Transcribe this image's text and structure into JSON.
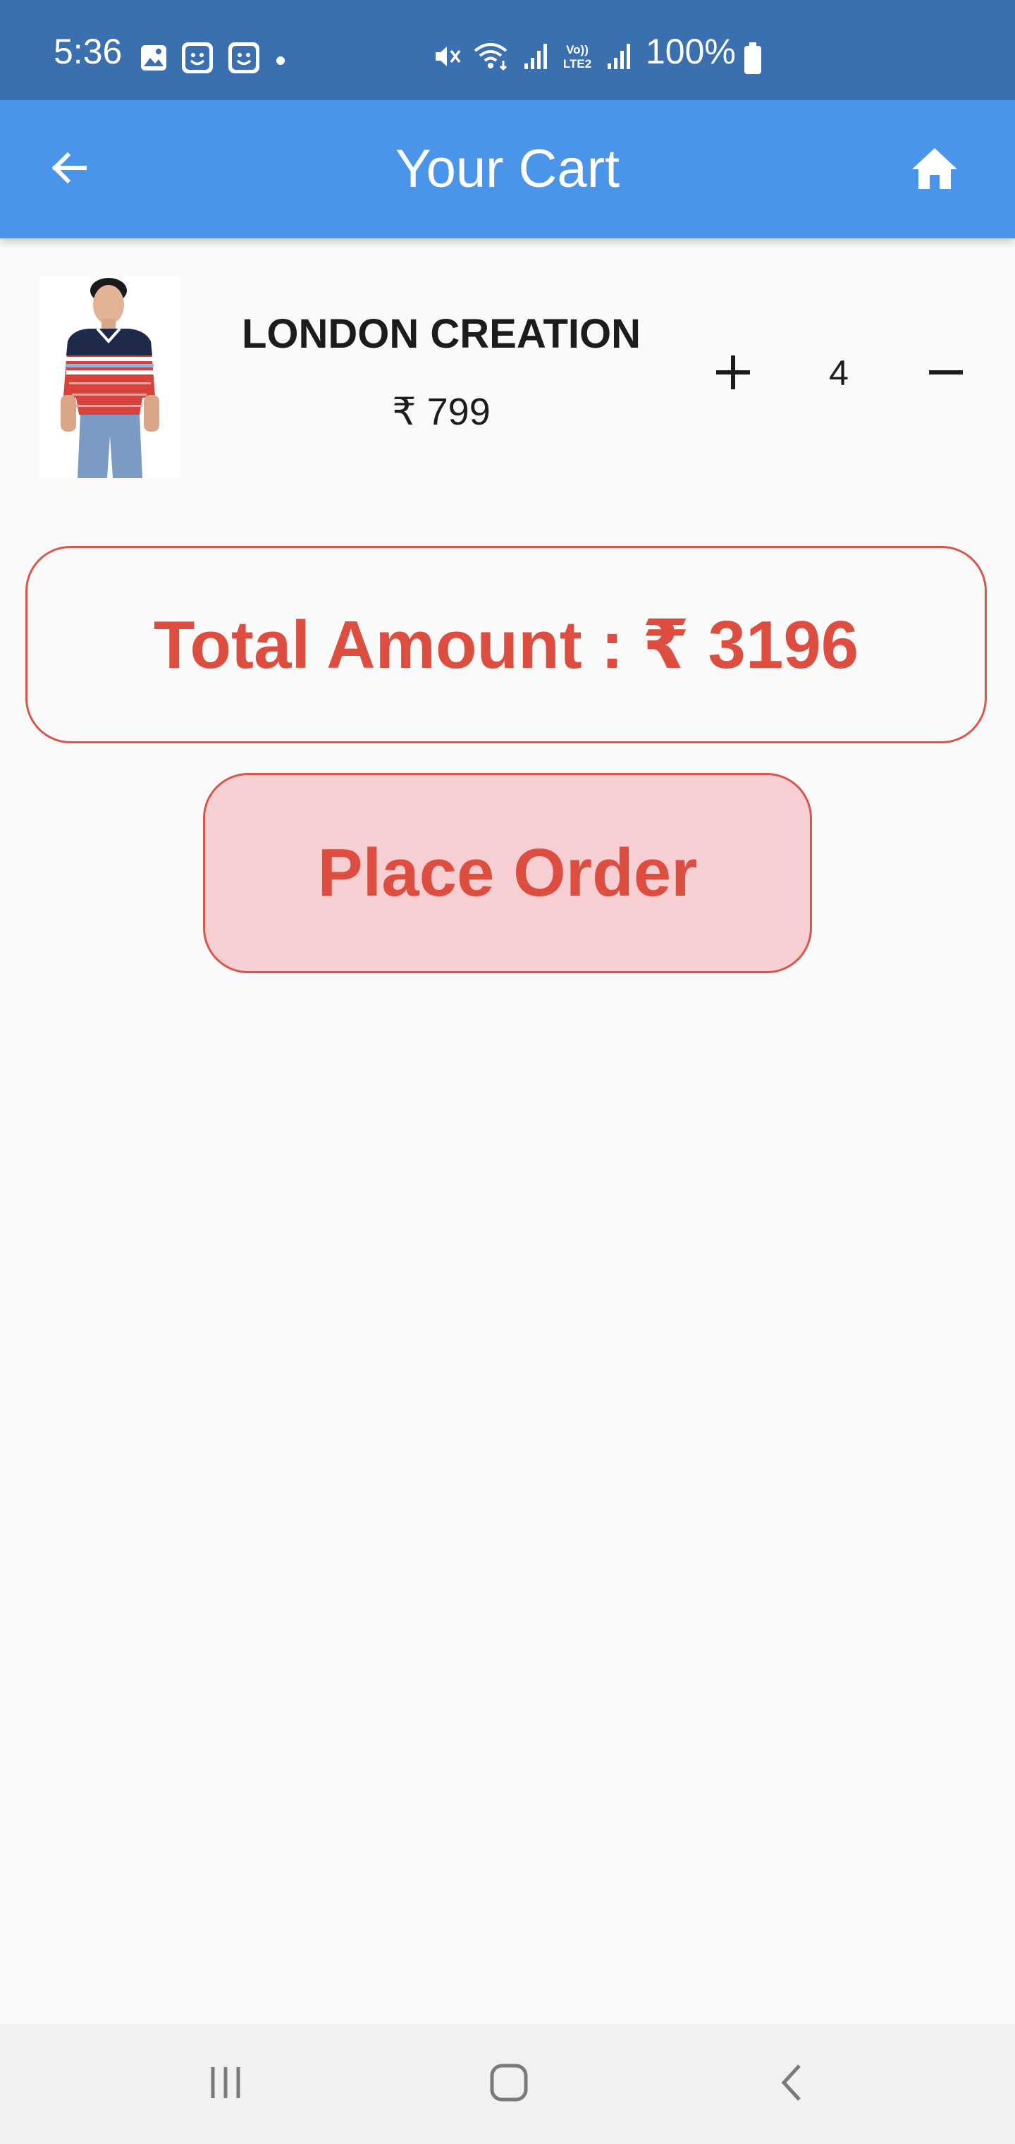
{
  "status_bar": {
    "time": "5:36",
    "battery_percent": "100%",
    "left_icons": [
      "gallery-icon",
      "face-icon",
      "face-icon",
      "dot-icon"
    ],
    "right_icons": [
      "mute-icon",
      "wifi-icon",
      "signal-icon",
      "volte-icon",
      "signal-icon",
      "battery-icon"
    ],
    "volte_label": "Vo))\nLTE2"
  },
  "app_bar": {
    "title": "Your Cart",
    "back_icon": "arrow-back-icon",
    "home_icon": "home-icon",
    "background": "#4a95e9"
  },
  "cart": {
    "items": [
      {
        "name": "LONDON CREATION",
        "price": "₹ 799",
        "quantity": "4",
        "plus_icon": "plus-icon",
        "minus_icon": "minus-icon"
      }
    ]
  },
  "summary": {
    "total_label": "Total Amount : ₹ 3196"
  },
  "actions": {
    "place_order_label": "Place Order",
    "accent_color": "#de4e40",
    "button_fill": "#f7cfd3"
  },
  "nav_bar": {
    "icons": [
      "recent-apps-icon",
      "home-nav-icon",
      "back-nav-icon"
    ]
  }
}
